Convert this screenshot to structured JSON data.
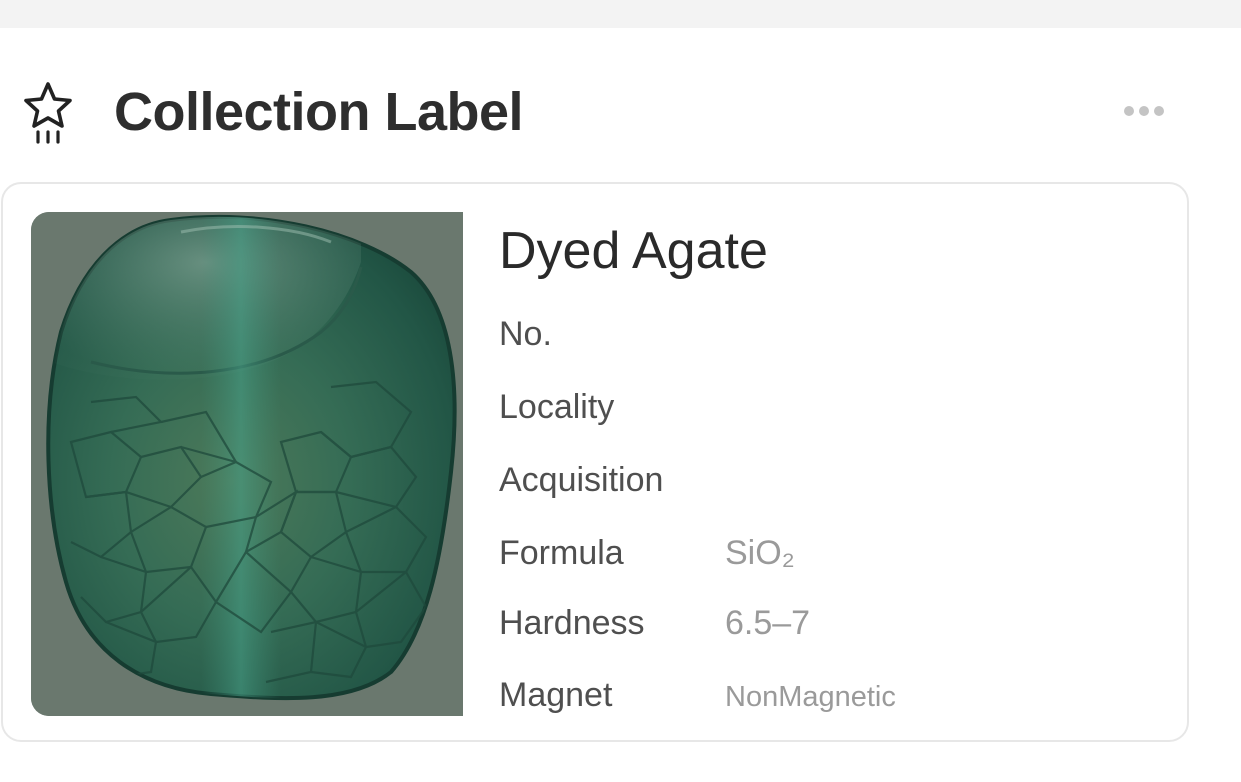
{
  "header": {
    "title": "Collection Label",
    "icon": "star-icon",
    "more_icon": "more-horizontal-icon"
  },
  "specimen": {
    "name": "Dyed Agate",
    "image_description_icon": "specimen-photo",
    "fields": [
      {
        "label": "No.",
        "value": ""
      },
      {
        "label": "Locality",
        "value": ""
      },
      {
        "label": "Acquisition",
        "value": ""
      },
      {
        "label": "Formula",
        "value": "SiO₂"
      },
      {
        "label": "Hardness",
        "value": "6.5–7"
      },
      {
        "label": "Magnet",
        "value": "NonMagnetic"
      }
    ]
  },
  "colors": {
    "title_text": "#2e2e2e",
    "label_text": "#4f4f4f",
    "value_text": "#9a9a9a",
    "card_border": "#e7e7e7",
    "photo_background": "#6b7a70",
    "stone_green": "#2f6b57"
  }
}
